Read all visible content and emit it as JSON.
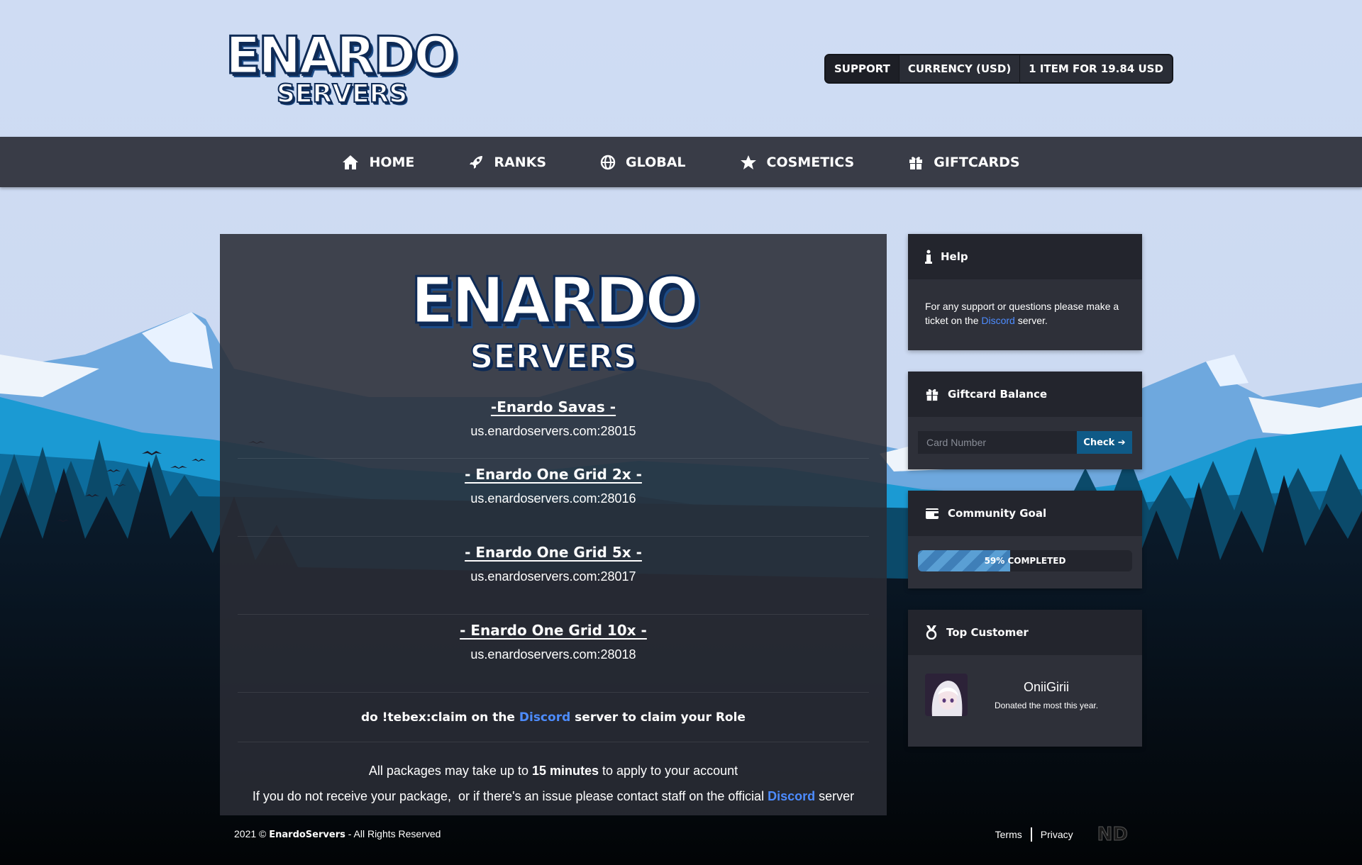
{
  "header": {
    "logo_top": "ENARDO",
    "logo_bottom": "SERVERS",
    "topbar": {
      "support_label": "SUPPORT",
      "currency_label": "CURRENCY (USD)",
      "cart_label": "1 ITEM FOR 19.84 USD"
    }
  },
  "nav": {
    "items": [
      {
        "label": "HOME",
        "icon": "home-icon"
      },
      {
        "label": "RANKS",
        "icon": "rocket-icon"
      },
      {
        "label": "GLOBAL",
        "icon": "globe-icon"
      },
      {
        "label": "COSMETICS",
        "icon": "star-icon"
      },
      {
        "label": "GIFTCARDS",
        "icon": "gift-icon"
      }
    ]
  },
  "main": {
    "logo_top": "ENARDO",
    "logo_bottom": "SERVERS",
    "servers": [
      {
        "name": "-Enardo Savas -",
        "address": "us.enardoservers.com:28015"
      },
      {
        "name": "- Enardo One Grid 2x -",
        "address": "us.enardoservers.com:28016"
      },
      {
        "name": "- Enardo One Grid 5x -",
        "address": "us.enardoservers.com:28017"
      },
      {
        "name": "- Enardo One Grid 10x -",
        "address": "us.enardoservers.com:28018"
      }
    ],
    "claim": {
      "before": "do !tebex:claim on the ",
      "link": "Discord",
      "after": " server to claim your Role"
    },
    "info": {
      "line1_before": "All packages may take up to ",
      "line1_bold": "15 minutes",
      "line1_after": " to apply to your account",
      "line2_before": "If you do not receive your package,  or if there's an issue please contact staff on the official ",
      "line2_link": "Discord",
      "line2_after": " server"
    }
  },
  "sidebar": {
    "help": {
      "title": "Help",
      "text_before": "For any support or questions please make a ticket on the ",
      "link": "Discord",
      "text_after": " server."
    },
    "giftcard": {
      "title": "Giftcard Balance",
      "placeholder": "Card Number",
      "button": "Check"
    },
    "goal": {
      "title": "Community Goal",
      "progress": 0.43,
      "label": "59% COMPLETED"
    },
    "top_customer": {
      "title": "Top Customer",
      "name": "OniiGirii",
      "subtitle": "Donated the most this year."
    }
  },
  "footer": {
    "year": "2021 © ",
    "brand": "EnardoServers",
    "rights": " - All Rights Reserved",
    "terms": "Terms",
    "privacy": "Privacy",
    "mark": "ND"
  },
  "colors": {
    "sky": "#cfdcf3",
    "navbar": "#393c47",
    "panel": "#2a2c36",
    "link": "#4d8cff",
    "button": "#0f5a87"
  }
}
